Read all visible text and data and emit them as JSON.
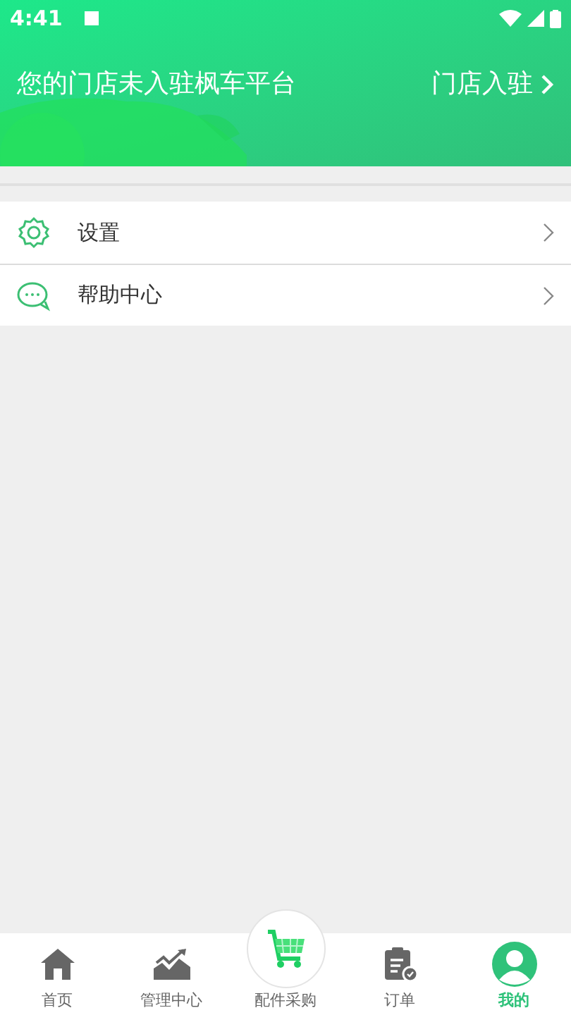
{
  "status_bar": {
    "time": "4:41"
  },
  "header": {
    "title": "您的门店未入驻枫车平台",
    "action": "门店入驻"
  },
  "menu": [
    {
      "kind": "settings",
      "label": "设置"
    },
    {
      "kind": "help",
      "label": "帮助中心"
    }
  ],
  "tab_bar": [
    {
      "kind": "home",
      "label": "首页",
      "selected": false
    },
    {
      "kind": "chart",
      "label": "管理中心",
      "selected": false
    },
    {
      "kind": "cart",
      "label": "配件采购",
      "selected": false
    },
    {
      "kind": "orders",
      "label": "订单",
      "selected": false
    },
    {
      "kind": "profile",
      "label": "我的",
      "selected": true
    }
  ]
}
